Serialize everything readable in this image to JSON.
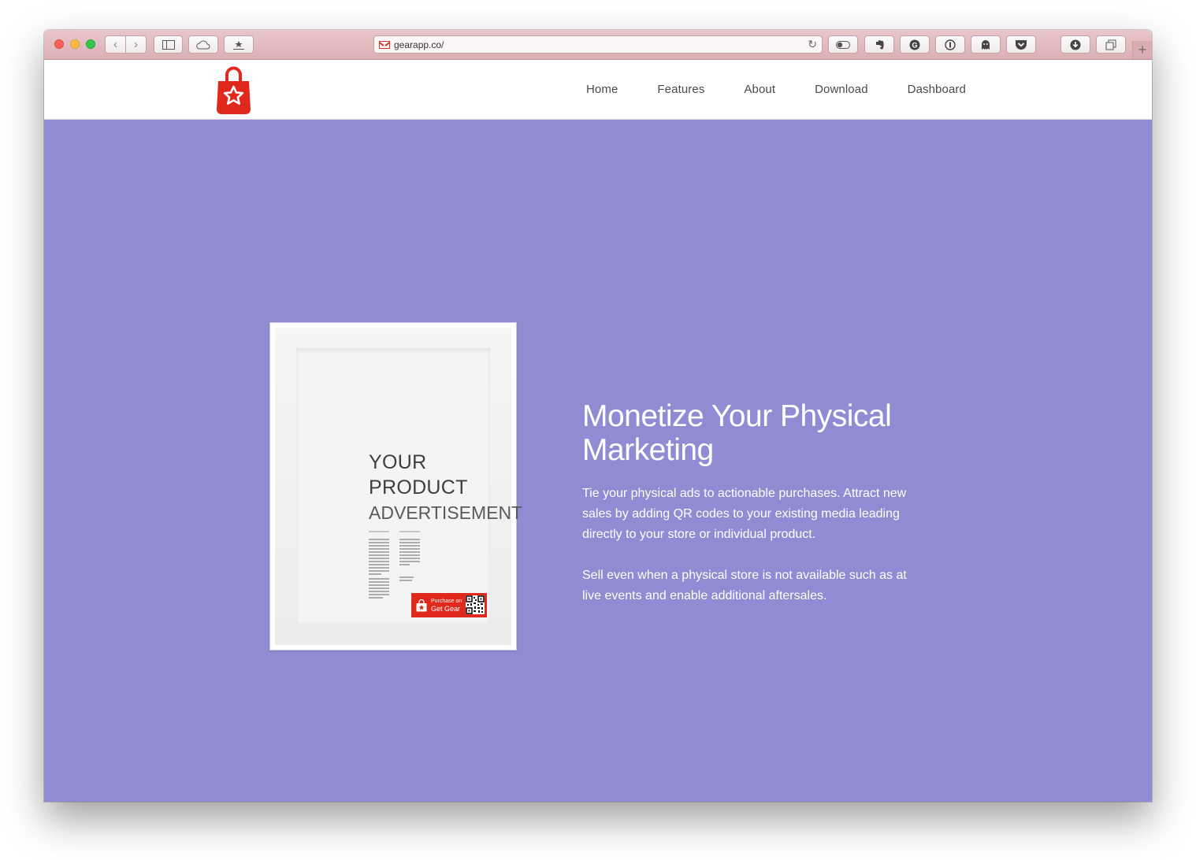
{
  "browser": {
    "url": "gearapp.co/",
    "new_tab_label": "+"
  },
  "nav": {
    "items": [
      {
        "label": "Home"
      },
      {
        "label": "Features"
      },
      {
        "label": "About"
      },
      {
        "label": "Download"
      },
      {
        "label": "Dashboard"
      }
    ]
  },
  "hero": {
    "background": "#8f8cd3",
    "title": "Monetize Your Physical Marketing",
    "paragraphs": [
      "Tie your physical ads to actionable purchases. Attract new sales by adding QR codes to your existing media leading directly to your store or individual product.",
      "Sell even when a physical store is not available such as at live events and enable additional aftersales."
    ],
    "poster": {
      "line1": "YOUR",
      "line2": "PRODUCT",
      "line3": "ADVERTISEMENT",
      "badge_line1": "Purchase on",
      "badge_line2": "Get Gear"
    }
  },
  "colors": {
    "brand_red": "#e0281c"
  }
}
